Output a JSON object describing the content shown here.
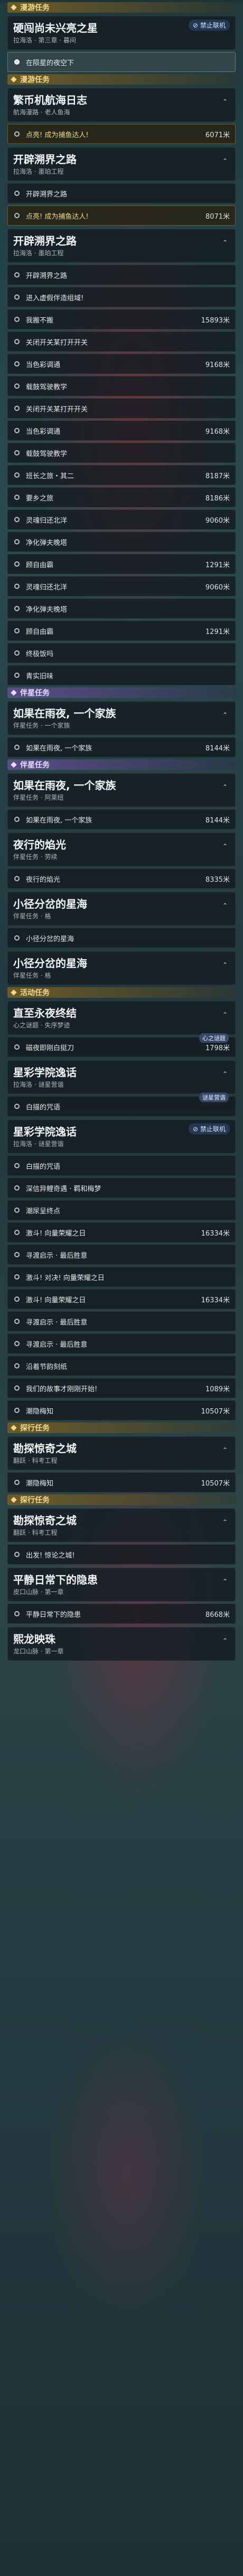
{
  "sections": [
    {
      "header": "漫游任务",
      "style": "sec-explore",
      "cards": [
        {
          "title": "硬闯尚未兴亮之星",
          "sub": "拉海洛 · 第三章 · 暮间",
          "rows": [
            {
              "label": "在陨星的夜空下",
              "dist": "",
              "type": "highlight"
            }
          ]
        }
      ]
    },
    {
      "header": "漫游任务",
      "style": "sec-explore",
      "cards": [
        {
          "title": "繁币机航海日志",
          "sub": "航海漫路 · 老人鱼海",
          "rows": [
            {
              "label": "点亮! 成为捕鱼达人!",
              "dist": "6071米",
              "type": "gold"
            }
          ]
        },
        {
          "title": "开辟溯界之路",
          "sub": "拉海洛 · 墨珀工程",
          "rows": [
            {
              "label": "开辟溯界之路",
              "dist": ""
            },
            {
              "label": "点亮! 成为捕鱼达人!",
              "dist": "8071米",
              "type": "gold"
            }
          ]
        },
        {
          "title": "开辟溯界之路",
          "sub": "拉海洛 · 墨珀工程",
          "rows": [
            {
              "label": "开辟溯界之路",
              "dist": ""
            },
            {
              "label": "进入虚假伴造组域!",
              "dist": ""
            },
            {
              "label": "我搬不搬",
              "dist": "15893米"
            },
            {
              "label": "关闭开关某打开开关",
              "dist": ""
            },
            {
              "label": "当色彩调通",
              "dist": "9168米"
            },
            {
              "label": "载鼓驾驶教学",
              "dist": ""
            },
            {
              "label": "关闭开关某打开开关",
              "dist": ""
            },
            {
              "label": "当色彩调通",
              "dist": "9168米"
            },
            {
              "label": "载鼓驾驶教学",
              "dist": ""
            },
            {
              "label": "班长之旅・其二",
              "dist": "8187米"
            },
            {
              "label": "要乡之旅",
              "dist": "8186米"
            },
            {
              "label": "灵魂归还北洋",
              "dist": "9060米"
            },
            {
              "label": "净化弹夫晚塔",
              "dist": ""
            },
            {
              "label": "顾自由霸",
              "dist": "1291米"
            },
            {
              "label": "灵魂归还北洋",
              "dist": "9060米"
            },
            {
              "label": "净化弹夫晚塔",
              "dist": ""
            },
            {
              "label": "顾自由霸",
              "dist": "1291米"
            },
            {
              "label": "终极饭吗",
              "dist": ""
            },
            {
              "label": "青实旧味",
              "dist": ""
            }
          ]
        }
      ]
    },
    {
      "header": "伴星任务",
      "style": "sec-companion",
      "cards": [
        {
          "title": "如果在雨夜, 一个家族",
          "sub": "伴星任务 · 一个家族",
          "rows": [
            {
              "label": "如果在雨夜, 一个家族",
              "dist": "8144米"
            }
          ]
        }
      ]
    },
    {
      "header": "伴星任务",
      "style": "sec-companion",
      "cards": [
        {
          "title": "如果在雨夜, 一个家族",
          "sub": "伴星任务 · 阿莱纽",
          "rows": [
            {
              "label": "如果在雨夜, 一个家族",
              "dist": "8144米"
            }
          ]
        },
        {
          "title": "夜行的焰光",
          "sub": "伴星任务 · 劳续",
          "rows": [
            {
              "label": "夜行的焰光",
              "dist": "8335米"
            }
          ]
        },
        {
          "title": "小径分岔的星海",
          "sub": "伴星任务 · 格",
          "rows": [
            {
              "label": "小径分岔的星海",
              "dist": ""
            }
          ]
        },
        {
          "title": "小径分岔的星海",
          "sub": "伴星任务 · 格",
          "rows": []
        }
      ]
    },
    {
      "header": "活动任务",
      "style": "sec-event",
      "cards": [
        {
          "title": "直至永夜终结",
          "sub": "心之谜题 · 失序梦迹",
          "rows": [
            {
              "label": "磁夜即刚白挺刀",
              "dist": "1798米",
              "tag": "心之谜题"
            }
          ]
        },
        {
          "title": "星彩学院逸话",
          "sub": "拉海洛 · 谜星营谐",
          "rows": [
            {
              "label": "白描的咒语",
              "dist": "",
              "tag": "谜星营谐"
            }
          ]
        },
        {
          "title": "星彩学院逸话",
          "sub": "拉海洛 · 谜星营谐",
          "rows": [
            {
              "label": "白描的咒语",
              "dist": ""
            },
            {
              "label": "深信异鲤奇遇 · 羁和梅梦",
              "dist": ""
            },
            {
              "label": "潮尿呈终点",
              "dist": ""
            },
            {
              "label": "激斗! 向量荣耀之日",
              "dist": "16334米"
            },
            {
              "label": "寻渡启示 · 最后胜意",
              "dist": ""
            },
            {
              "label": "激斗! 对决! 向量荣耀之日",
              "dist": ""
            },
            {
              "label": "激斗! 向量荣耀之日",
              "dist": "16334米"
            },
            {
              "label": "寻渡启示 · 最后胜意",
              "dist": ""
            },
            {
              "label": "寻渡启示 · 最后胜意",
              "dist": ""
            },
            {
              "label": "沿着节韵刻纸",
              "dist": ""
            },
            {
              "label": "我们的故事才刚刚开始!",
              "dist": "1089米"
            },
            {
              "label": "潮隐梅知",
              "dist": "10507米"
            }
          ]
        }
      ]
    },
    {
      "header": "探行任务",
      "style": "sec-trail",
      "cards": [
        {
          "title": "勘探惊奇之城",
          "sub": "翻跃 · 科考工程",
          "rows": [
            {
              "label": "潮隐梅知",
              "dist": "10507米"
            }
          ]
        }
      ]
    },
    {
      "header": "探行任务",
      "style": "sec-trail",
      "cards": [
        {
          "title": "勘探惊奇之城",
          "sub": "翻跃 · 科考工程",
          "rows": [
            {
              "label": "出发! 惊论之城!",
              "dist": ""
            }
          ]
        },
        {
          "title": "平静日常下的隐患",
          "sub": "皮口山脉 · 第一章",
          "rows": [
            {
              "label": "平静日常下的隐患",
              "dist": "8668米"
            }
          ]
        },
        {
          "title": "熙龙映珠",
          "sub": "龙口山脉 · 第一章",
          "rows": []
        }
      ]
    }
  ],
  "overlay_badges": [
    {
      "label": "禁止联机",
      "at_section": 0
    },
    {
      "label": "禁止联机",
      "at_section": 4
    }
  ]
}
